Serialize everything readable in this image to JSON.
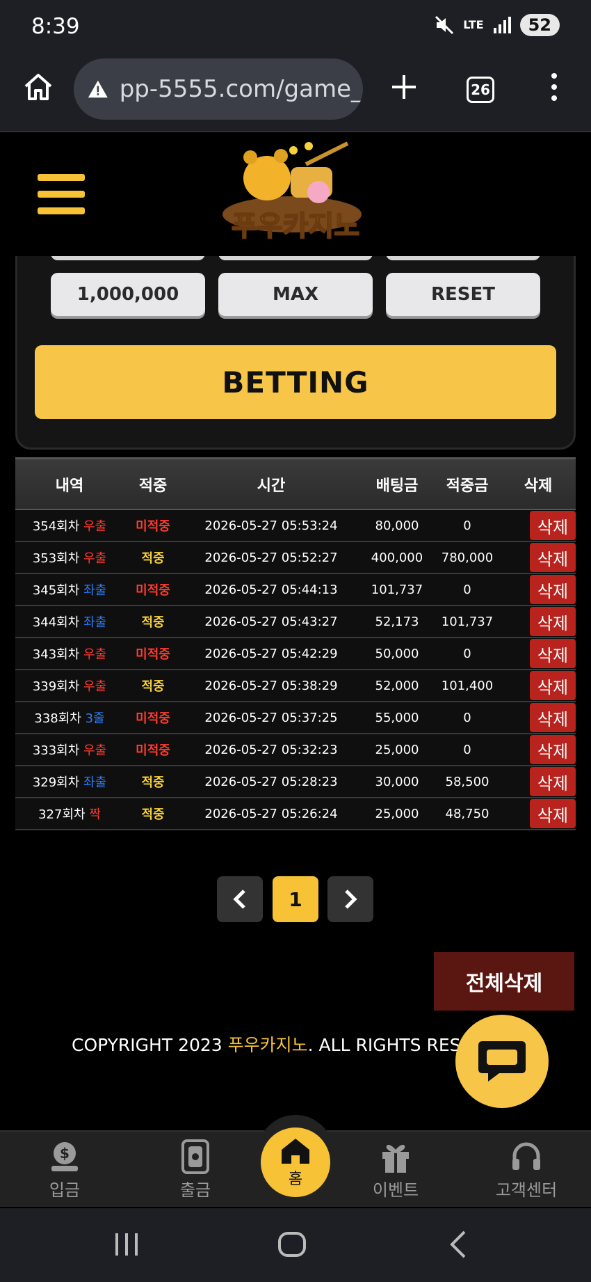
{
  "status_bar": {
    "time": "8:39",
    "network": "LTE",
    "battery": "52"
  },
  "browser": {
    "url": "pp-5555.com/game_",
    "tab_count": "26"
  },
  "site": {
    "logo_text": "푸우카지노"
  },
  "bet_buttons": {
    "amount": "1,000,000",
    "max": "MAX",
    "reset": "RESET",
    "betting": "BETTING"
  },
  "table": {
    "headers": [
      "내역",
      "적중",
      "시간",
      "배팅금",
      "적중금",
      "삭제"
    ],
    "delete_label": "삭제",
    "rows": [
      {
        "round": "354회차",
        "pick": "우출",
        "pick_color": "#ff3b2f",
        "result": "미적중",
        "time": "2026-05-27 05:53:24",
        "bet": "80,000",
        "win": "0"
      },
      {
        "round": "353회차",
        "pick": "우출",
        "pick_color": "#ff3b2f",
        "result": "적중",
        "time": "2026-05-27 05:52:27",
        "bet": "400,000",
        "win": "780,000"
      },
      {
        "round": "345회차",
        "pick": "좌출",
        "pick_color": "#2f7cf6",
        "result": "미적중",
        "time": "2026-05-27 05:44:13",
        "bet": "101,737",
        "win": "0"
      },
      {
        "round": "344회차",
        "pick": "좌출",
        "pick_color": "#2f7cf6",
        "result": "적중",
        "time": "2026-05-27 05:43:27",
        "bet": "52,173",
        "win": "101,737"
      },
      {
        "round": "343회차",
        "pick": "우출",
        "pick_color": "#ff3b2f",
        "result": "미적중",
        "time": "2026-05-27 05:42:29",
        "bet": "50,000",
        "win": "0"
      },
      {
        "round": "339회차",
        "pick": "우출",
        "pick_color": "#ff3b2f",
        "result": "적중",
        "time": "2026-05-27 05:38:29",
        "bet": "52,000",
        "win": "101,400"
      },
      {
        "round": "338회차",
        "pick": "3줄",
        "pick_color": "#2f7cf6",
        "result": "미적중",
        "time": "2026-05-27 05:37:25",
        "bet": "55,000",
        "win": "0"
      },
      {
        "round": "333회차",
        "pick": "우출",
        "pick_color": "#ff3b2f",
        "result": "미적중",
        "time": "2026-05-27 05:32:23",
        "bet": "25,000",
        "win": "0"
      },
      {
        "round": "329회차",
        "pick": "좌출",
        "pick_color": "#2f7cf6",
        "result": "적중",
        "time": "2026-05-27 05:28:23",
        "bet": "30,000",
        "win": "58,500"
      },
      {
        "round": "327회차",
        "pick": "짝",
        "pick_color": "#ff3b2f",
        "result": "적중",
        "time": "2026-05-27 05:26:24",
        "bet": "25,000",
        "win": "48,750"
      }
    ]
  },
  "pagination": {
    "current": "1"
  },
  "delete_all": "전체삭제",
  "footer": {
    "prefix": "COPYRIGHT 2023 ",
    "brand": "푸우카지노",
    "suffix": ". ALL RIGHTS RESERVED"
  },
  "bottom_nav": {
    "deposit": "입금",
    "withdraw": "출금",
    "home": "홈",
    "event": "이벤트",
    "support": "고객센터"
  },
  "colors": {
    "accent": "#f7c236",
    "danger": "#b8231e",
    "miss": "#ff3b2f",
    "hit": "#f7d23a"
  }
}
